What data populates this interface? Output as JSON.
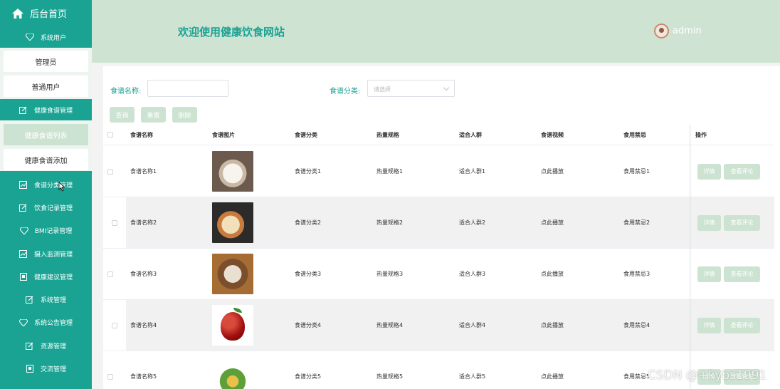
{
  "sidebar": {
    "home": "后台首页",
    "groups": [
      {
        "label": "系统用户",
        "icon": "diamond-icon",
        "items": [
          "管理员",
          "普通用户"
        ]
      },
      {
        "label": "健康食谱管理",
        "icon": "edit-icon",
        "items": [
          "健康食谱列表",
          "健康食谱添加"
        ],
        "active": "健康食谱列表"
      }
    ],
    "more": [
      {
        "label": "食谱分类管理",
        "icon": "chart-icon"
      },
      {
        "label": "饮食记录管理",
        "icon": "edit-icon"
      },
      {
        "label": "BMI记录管理",
        "icon": "diamond-icon"
      },
      {
        "label": "摄入监测管理",
        "icon": "chart-icon"
      },
      {
        "label": "健康建议管理",
        "icon": "doc-icon"
      },
      {
        "label": "系统管理",
        "icon": "edit-icon"
      },
      {
        "label": "系统公告管理",
        "icon": "diamond-icon"
      },
      {
        "label": "资源管理",
        "icon": "edit-icon"
      },
      {
        "label": "交流管理",
        "icon": "doc-icon"
      }
    ]
  },
  "header": {
    "title": "欢迎使用健康饮食网站",
    "user": "admin"
  },
  "search": {
    "name_label": "食谱名称:",
    "name_value": "",
    "category_label": "食谱分类:",
    "category_placeholder": "请选择",
    "buttons": {
      "query": "查询",
      "reset": "重置",
      "delete": "删除"
    }
  },
  "table": {
    "columns": [
      "食谱名称",
      "食谱图片",
      "食谱分类",
      "热量规格",
      "适合人群",
      "食谱视频",
      "食用禁忌",
      "操作"
    ],
    "rows": [
      {
        "name": "食谱名称1",
        "category": "食谱分类1",
        "calorie": "热量规格1",
        "crowd": "适合人群1",
        "video": "点此播放",
        "taboo": "食用禁忌1"
      },
      {
        "name": "食谱名称2",
        "category": "食谱分类2",
        "calorie": "热量规格2",
        "crowd": "适合人群2",
        "video": "点此播放",
        "taboo": "食用禁忌2"
      },
      {
        "name": "食谱名称3",
        "category": "食谱分类3",
        "calorie": "热量规格3",
        "crowd": "适合人群3",
        "video": "点此播放",
        "taboo": "食用禁忌3"
      },
      {
        "name": "食谱名称4",
        "category": "食谱分类4",
        "calorie": "热量规格4",
        "crowd": "适合人群4",
        "video": "点此播放",
        "taboo": "食用禁忌4"
      },
      {
        "name": "食谱名称5",
        "category": "食谱分类5",
        "calorie": "热量规格5",
        "crowd": "适合人群5",
        "video": "点此播放",
        "taboo": "食用禁忌5"
      }
    ],
    "actions": {
      "detail": "详情",
      "comments": "查看评论"
    }
  },
  "watermark": "CSDN @+kybs1991",
  "colors": {
    "accent": "#1aa393",
    "header_bg": "#cfe3d3",
    "button_bg": "#cde3d2"
  }
}
